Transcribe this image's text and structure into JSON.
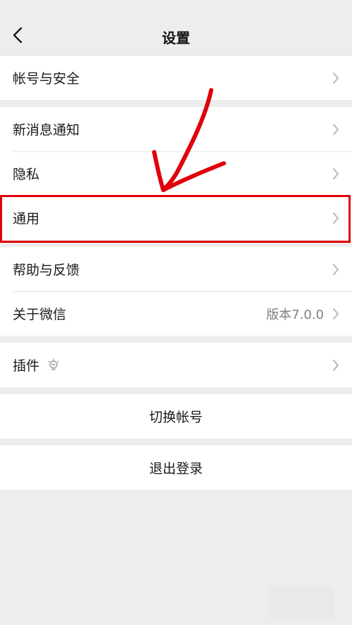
{
  "header": {
    "title": "设置"
  },
  "groups": [
    {
      "items": [
        {
          "label": "帐号与安全"
        }
      ]
    },
    {
      "items": [
        {
          "label": "新消息通知"
        },
        {
          "label": "隐私"
        },
        {
          "label": "通用"
        }
      ]
    },
    {
      "items": [
        {
          "label": "帮助与反馈"
        },
        {
          "label": "关于微信",
          "value": "版本7.0.0"
        }
      ]
    },
    {
      "items": [
        {
          "label": "插件",
          "icon": "bulb-icon"
        }
      ]
    }
  ],
  "actions": {
    "switch_account": "切换帐号",
    "logout": "退出登录"
  },
  "colors": {
    "background": "#EDEDED",
    "cell": "#FFFFFF",
    "annotation": "#E0000B"
  }
}
